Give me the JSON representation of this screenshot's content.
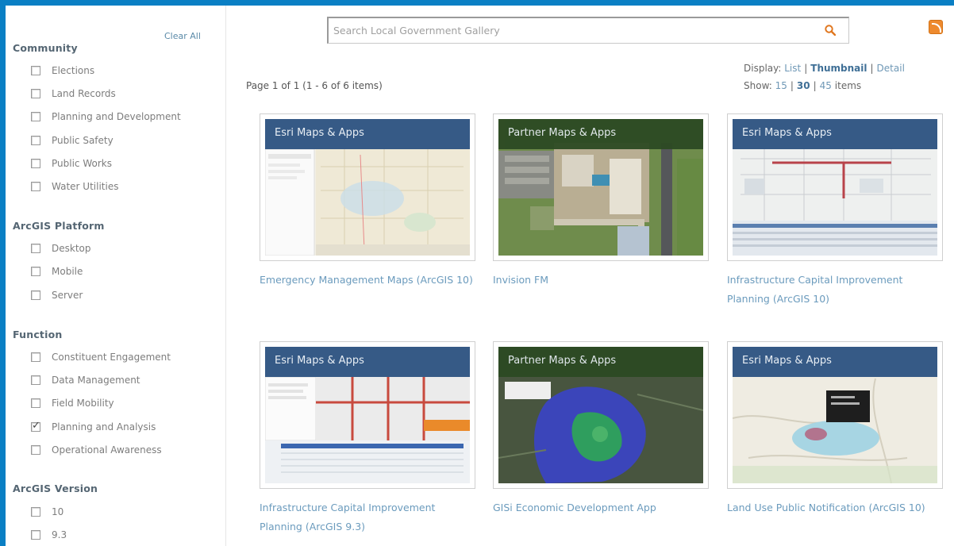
{
  "sidebar": {
    "clear_all": "Clear All",
    "groups": [
      {
        "title": "Community",
        "items": [
          {
            "label": "Elections",
            "checked": false
          },
          {
            "label": "Land Records",
            "checked": false
          },
          {
            "label": "Planning and Development",
            "checked": false
          },
          {
            "label": "Public Safety",
            "checked": false
          },
          {
            "label": "Public Works",
            "checked": false
          },
          {
            "label": "Water Utilities",
            "checked": false
          }
        ]
      },
      {
        "title": "ArcGIS Platform",
        "items": [
          {
            "label": "Desktop",
            "checked": false
          },
          {
            "label": "Mobile",
            "checked": false
          },
          {
            "label": "Server",
            "checked": false
          }
        ]
      },
      {
        "title": "Function",
        "items": [
          {
            "label": "Constituent Engagement",
            "checked": false
          },
          {
            "label": "Data Management",
            "checked": false
          },
          {
            "label": "Field Mobility",
            "checked": false
          },
          {
            "label": "Planning and Analysis",
            "checked": true
          },
          {
            "label": "Operational Awareness",
            "checked": false
          }
        ]
      },
      {
        "title": "ArcGIS Version",
        "items": [
          {
            "label": "10",
            "checked": false
          },
          {
            "label": "9.3",
            "checked": false
          }
        ]
      }
    ]
  },
  "search": {
    "placeholder": "Search Local Government Gallery",
    "icon": "search-icon"
  },
  "rss_icon": "rss-icon",
  "results": {
    "page_info": "Page 1 of 1 (1 - 6 of 6 items)",
    "display_label": "Display:",
    "display_list": "List",
    "display_thumbnail": "Thumbnail",
    "display_detail": "Detail",
    "show_label": "Show:",
    "show_15": "15",
    "show_30": "30",
    "show_45": "45",
    "show_items": "items",
    "separator": "|"
  },
  "cards": [
    {
      "banner": "Esri Maps & Apps",
      "kind": "esri",
      "title": "Emergency Management Maps (ArcGIS 10)"
    },
    {
      "banner": "Partner Maps & Apps",
      "kind": "partner",
      "title": "Invision FM"
    },
    {
      "banner": "Esri Maps & Apps",
      "kind": "esri",
      "title": "Infrastructure Capital Improvement Planning (ArcGIS 10)"
    },
    {
      "banner": "Esri Maps & Apps",
      "kind": "esri",
      "title": "Infrastructure Capital Improvement Planning (ArcGIS 9.3)"
    },
    {
      "banner": "Partner Maps & Apps",
      "kind": "partner",
      "title": "GISi Economic Development App"
    },
    {
      "banner": "Esri Maps & Apps",
      "kind": "esri",
      "title": "Land Use Public Notification (ArcGIS 10)"
    }
  ],
  "colors": {
    "frame_border": "#0a7fc4",
    "esri_banner": "#365a86",
    "partner_banner": "#2c4a23",
    "link": "#6b9bbd"
  }
}
